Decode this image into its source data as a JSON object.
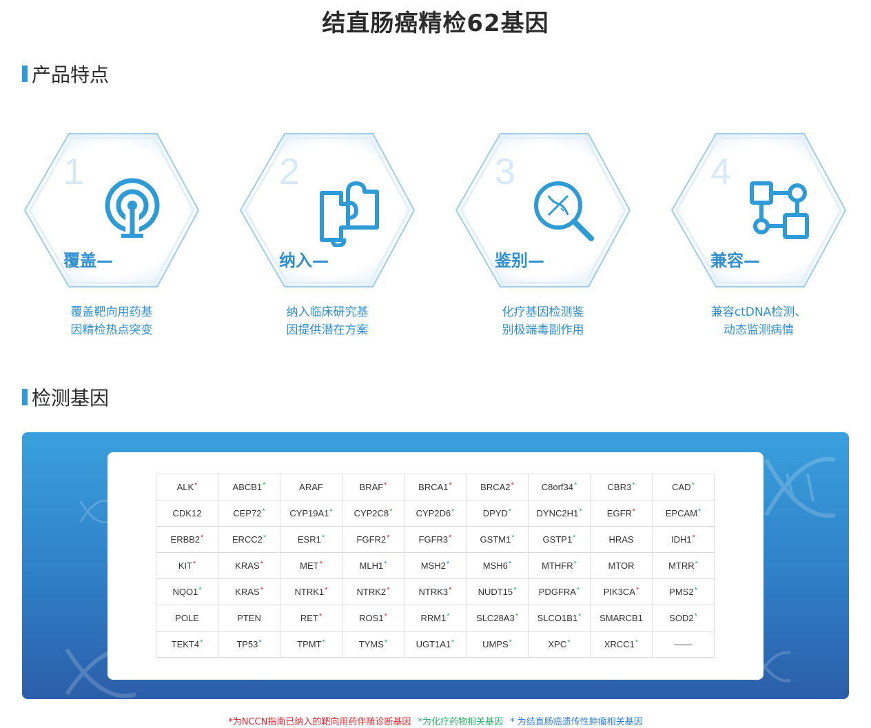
{
  "title": "结直肠癌精检62基因",
  "sections": {
    "features_heading": "产品特点",
    "genes_heading": "检测基因"
  },
  "features": [
    {
      "num": "1",
      "title": "覆盖—",
      "icon": "radio-tower-icon",
      "desc_line1": "覆盖靶向用药基",
      "desc_line2": "因精检热点突变"
    },
    {
      "num": "2",
      "title": "纳入—",
      "icon": "puzzle-icon",
      "desc_line1": "纳入临床研究基",
      "desc_line2": "因提供潜在方案"
    },
    {
      "num": "3",
      "title": "鉴别—",
      "icon": "dna-magnifier-icon",
      "desc_line1": "化疗基因检测鉴",
      "desc_line2": "别极端毒副作用"
    },
    {
      "num": "4",
      "title": "兼容—",
      "icon": "flowchart-icon",
      "desc_line1": "兼容ctDNA检测、",
      "desc_line2": "动态监测病情"
    }
  ],
  "colors": {
    "accent": "#2f9bd6",
    "feature_text": "#2f8fcf",
    "mark_red": "#e0262f",
    "mark_green": "#27b36a",
    "mark_blue": "#2f7fd6"
  },
  "genes": [
    {
      "name": "ALK",
      "mark": "*",
      "color": "red"
    },
    {
      "name": "ABCB1",
      "mark": "*",
      "color": "green"
    },
    {
      "name": "ARAF",
      "mark": "",
      "color": ""
    },
    {
      "name": "BRAF",
      "mark": "*",
      "color": "red"
    },
    {
      "name": "BRCA1",
      "mark": "*",
      "color": "red"
    },
    {
      "name": "BRCA2",
      "mark": "*",
      "color": "red"
    },
    {
      "name": "C8orf34",
      "mark": "*",
      "color": "green"
    },
    {
      "name": "CBR3",
      "mark": "*",
      "color": "green"
    },
    {
      "name": "CAD",
      "mark": "*",
      "color": "green"
    },
    {
      "name": "CDK12",
      "mark": "",
      "color": ""
    },
    {
      "name": "CEP72",
      "mark": "*",
      "color": "green"
    },
    {
      "name": "CYP19A1",
      "mark": "*",
      "color": "green"
    },
    {
      "name": "CYP2C8",
      "mark": "*",
      "color": "green"
    },
    {
      "name": "CYP2D6",
      "mark": "*",
      "color": "green"
    },
    {
      "name": "DPYD",
      "mark": "*",
      "color": "green"
    },
    {
      "name": "DYNC2H1",
      "mark": "*",
      "color": "green"
    },
    {
      "name": "EGFR",
      "mark": "*",
      "color": "red"
    },
    {
      "name": "EPCAM",
      "mark": "*",
      "color": "blue"
    },
    {
      "name": "ERBB2",
      "mark": "*",
      "color": "red"
    },
    {
      "name": "ERCC2",
      "mark": "*",
      "color": "green"
    },
    {
      "name": "ESR1",
      "mark": "*",
      "color": "green"
    },
    {
      "name": "FGFR2",
      "mark": "*",
      "color": "red"
    },
    {
      "name": "FGFR3",
      "mark": "*",
      "color": "red"
    },
    {
      "name": "GSTM1",
      "mark": "*",
      "color": "green"
    },
    {
      "name": "GSTP1",
      "mark": "*",
      "color": "green"
    },
    {
      "name": "HRAS",
      "mark": "",
      "color": ""
    },
    {
      "name": "IDH1",
      "mark": "*",
      "color": "red"
    },
    {
      "name": "KIT",
      "mark": "*",
      "color": "red"
    },
    {
      "name": "KRAS",
      "mark": "*",
      "color": "red"
    },
    {
      "name": "MET",
      "mark": "*",
      "color": "red"
    },
    {
      "name": "MLH1",
      "mark": "*",
      "color": "blue"
    },
    {
      "name": "MSH2",
      "mark": "*",
      "color": "blue"
    },
    {
      "name": "MSH6",
      "mark": "*",
      "color": "blue"
    },
    {
      "name": "MTHFR",
      "mark": "*",
      "color": "green"
    },
    {
      "name": "MTOR",
      "mark": "",
      "color": ""
    },
    {
      "name": "MTRR",
      "mark": "*",
      "color": "green"
    },
    {
      "name": "NQO1",
      "mark": "*",
      "color": "green"
    },
    {
      "name": "KRAS",
      "mark": "*",
      "color": "red"
    },
    {
      "name": "NTRK1",
      "mark": "*",
      "color": "red"
    },
    {
      "name": "NTRK2",
      "mark": "*",
      "color": "red"
    },
    {
      "name": "NTRK3",
      "mark": "*",
      "color": "red"
    },
    {
      "name": "NUDT15",
      "mark": "*",
      "color": "green"
    },
    {
      "name": "PDGFRA",
      "mark": "*",
      "color": "green"
    },
    {
      "name": "PIK3CA",
      "mark": "*",
      "color": "red"
    },
    {
      "name": "PMS2",
      "mark": "*",
      "color": "blue"
    },
    {
      "name": "POLE",
      "mark": "",
      "color": ""
    },
    {
      "name": "PTEN",
      "mark": "",
      "color": ""
    },
    {
      "name": "RET",
      "mark": "*",
      "color": "red"
    },
    {
      "name": "ROS1",
      "mark": "*",
      "color": "red"
    },
    {
      "name": "RRM1",
      "mark": "*",
      "color": "green"
    },
    {
      "name": "SLC28A3",
      "mark": "*",
      "color": "green"
    },
    {
      "name": "SLCO1B1",
      "mark": "*",
      "color": "green"
    },
    {
      "name": "SMARCB1",
      "mark": "",
      "color": ""
    },
    {
      "name": "SOD2",
      "mark": "*",
      "color": "green"
    },
    {
      "name": "TEKT4",
      "mark": "*",
      "color": "green"
    },
    {
      "name": "TP53",
      "mark": "*",
      "color": "blue"
    },
    {
      "name": "TPMT",
      "mark": "*",
      "color": "green"
    },
    {
      "name": "TYMS",
      "mark": "*",
      "color": "green"
    },
    {
      "name": "UGT1A1",
      "mark": "*",
      "color": "green"
    },
    {
      "name": "UMPS",
      "mark": "*",
      "color": "green"
    },
    {
      "name": "XPC",
      "mark": "*",
      "color": "green"
    },
    {
      "name": "XRCC1",
      "mark": "*",
      "color": "green"
    },
    {
      "name": "——",
      "mark": "",
      "color": ""
    }
  ],
  "legend": {
    "red": "*为NCCN指南已纳入的靶向用药伴随诊断基因",
    "green": "*为化疗药物相关基因",
    "blue": "* 为结直肠癌遗传性肿瘤相关基因"
  }
}
